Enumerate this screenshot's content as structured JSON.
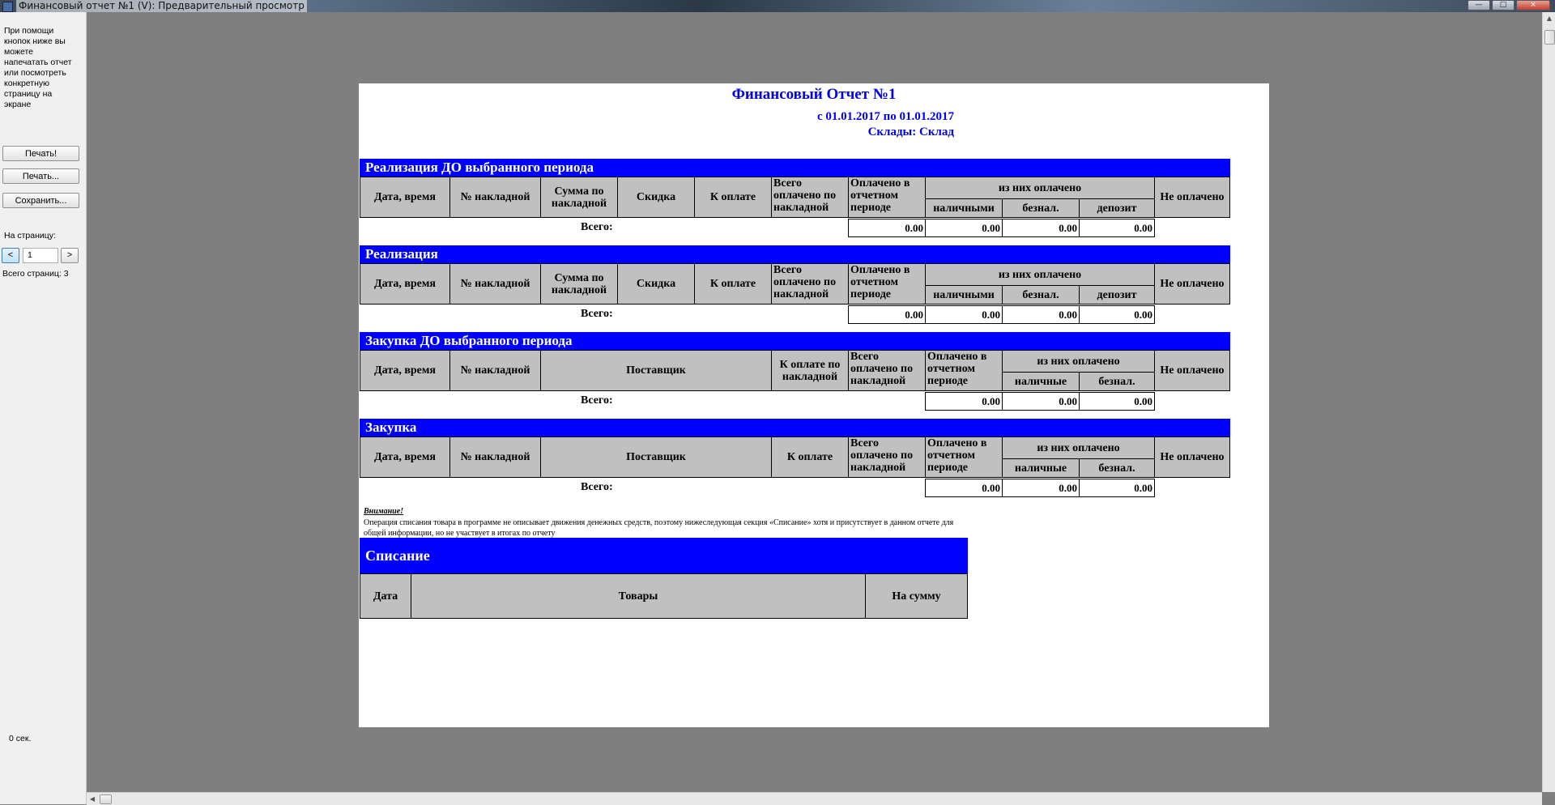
{
  "window": {
    "title": "Финансовый отчет №1 (V): Предварительный просмотр",
    "controls": [
      "—",
      "□",
      "×"
    ]
  },
  "sidebar": {
    "hint": "При помощи кнопок ниже вы можете напечатать отчет или посмотреть конкретную страницу на экране",
    "print_label": "Печать!",
    "print_dialog_label": "Печать...",
    "save_label": "Сохранить...",
    "page_label": "На страницу:",
    "prev_label": "<",
    "page_value": "1",
    "next_label": ">",
    "total_pages": "Всего страниц: 3",
    "timer": "0 сек."
  },
  "report": {
    "title": "Финансовый Отчет №1",
    "period": "с 01.01.2017 по 01.01.2017",
    "stores": "Склады:  Склад",
    "warning_title": "Внимание!",
    "warning_text": "Операция списания товара в программе не описывает движения денежных средств, поэтому нижеследующая секция «Списание» хотя и присутствует в данном отчете для общей информации, но не участвует в итогах по отчету",
    "sections": [
      {
        "title": "Реализация ДО выбранного периода",
        "headers": {
          "date": "Дата, время",
          "invoice": "№ накладной",
          "invoice_sum": "Сумма по накладной",
          "discount": "Скидка",
          "to_pay": "К оплате",
          "total_paid": "Всего оплачено по накладной",
          "paid_period": "Оплачено в отчетном периоде",
          "of_which": "из них оплачено",
          "cash": "наличными",
          "noncash": "безнал.",
          "deposit": "депозит",
          "unpaid": "Не оплачено"
        },
        "total_label": "Всего:",
        "totals": [
          "0.00",
          "0.00",
          "0.00",
          "0.00"
        ]
      },
      {
        "title": "Реализация",
        "headers": {
          "date": "Дата, время",
          "invoice": "№ накладной",
          "invoice_sum": "Сумма по накладной",
          "discount": "Скидка",
          "to_pay": "К оплате",
          "total_paid": "Всего оплачено по накладной",
          "paid_period": "Оплачено в отчетном периоде",
          "of_which": "из них оплачено",
          "cash": "наличными",
          "noncash": "безнал.",
          "deposit": "депозит",
          "unpaid": "Не оплачено"
        },
        "total_label": "Всего:",
        "totals": [
          "0.00",
          "0.00",
          "0.00",
          "0.00"
        ]
      },
      {
        "title": "Закупка ДО выбранного периода",
        "headers": {
          "date": "Дата, время",
          "invoice": "№ накладной",
          "supplier": "Поставщик",
          "to_pay": "К оплате по накладной",
          "total_paid": "Всего оплачено по накладной",
          "paid_period": "Оплачено в отчетном периоде",
          "of_which": "из них оплачено",
          "cash": "наличные",
          "noncash": "безнал.",
          "unpaid": "Не оплачено"
        },
        "total_label": "Всего:",
        "totals": [
          "0.00",
          "0.00",
          "0.00"
        ]
      },
      {
        "title": "Закупка",
        "headers": {
          "date": "Дата, время",
          "invoice": "№ накладной",
          "supplier": "Поставщик",
          "to_pay": "К оплате",
          "total_paid": "Всего оплачено по накладной",
          "paid_period": "Оплачено в отчетном периоде",
          "of_which": "из них оплачено",
          "cash": "наличные",
          "noncash": "безнал.",
          "unpaid": "Не оплачено"
        },
        "total_label": "Всего:",
        "totals": [
          "0.00",
          "0.00",
          "0.00"
        ]
      }
    ],
    "writeoff": {
      "title": "Списание",
      "headers": {
        "date": "Дата",
        "goods": "Товары",
        "amount": "На сумму"
      }
    }
  }
}
